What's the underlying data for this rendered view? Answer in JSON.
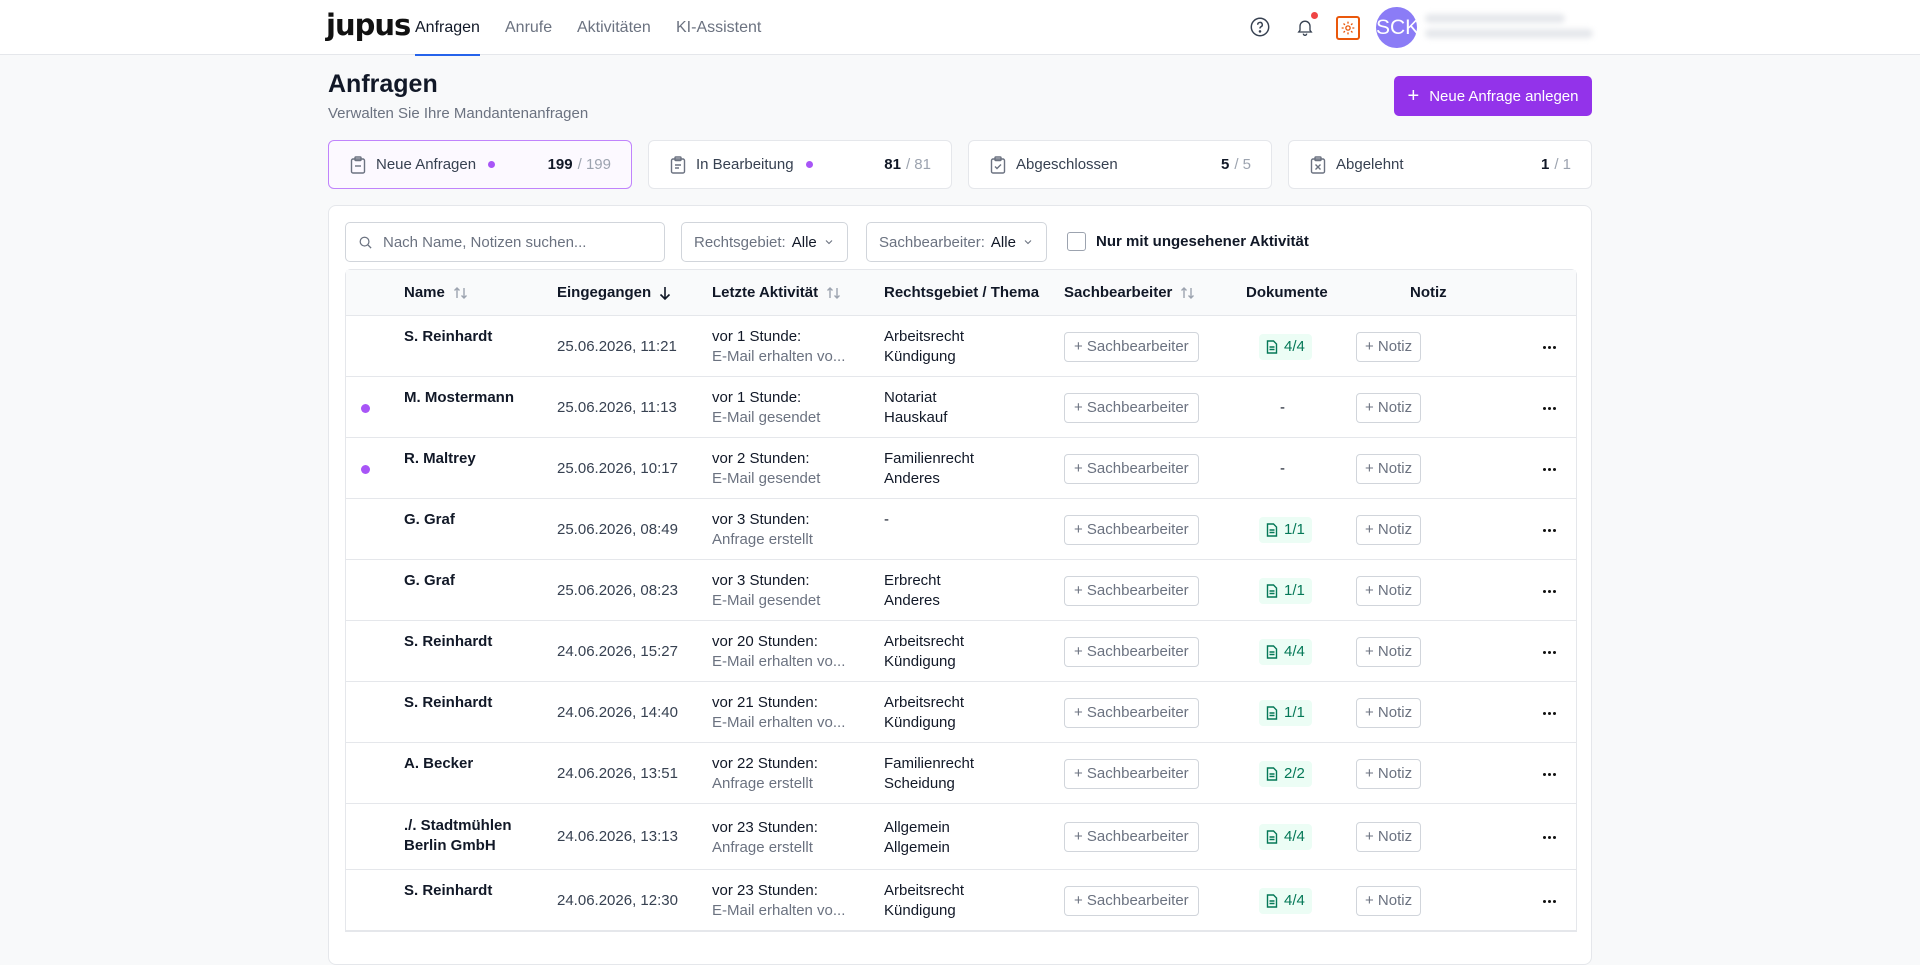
{
  "nav": {
    "logo": "jupus",
    "tabs": [
      "Anfragen",
      "Anrufe",
      "Aktivitäten",
      "KI-Assistent"
    ],
    "avatar_initials": "SCK"
  },
  "header": {
    "title": "Anfragen",
    "subtitle": "Verwalten Sie Ihre Mandantenanfragen",
    "new_button": "Neue Anfrage anlegen"
  },
  "status_cards": [
    {
      "label": "Neue Anfragen",
      "count": "199",
      "total": "/ 199",
      "dot": true
    },
    {
      "label": "In Bearbeitung",
      "count": "81",
      "total": "/ 81",
      "dot": true
    },
    {
      "label": "Abgeschlossen",
      "count": "5",
      "total": "/ 5",
      "dot": false
    },
    {
      "label": "Abgelehnt",
      "count": "1",
      "total": "/ 1",
      "dot": false
    }
  ],
  "filters": {
    "search_placeholder": "Nach Name, Notizen suchen...",
    "rechtsgebiet_label": "Rechtsgebiet:",
    "rechtsgebiet_value": "Alle",
    "sachbearbeiter_label": "Sachbearbeiter:",
    "sachbearbeiter_value": "Alle",
    "unseen_label": "Nur mit ungesehener Aktivität"
  },
  "table": {
    "columns": {
      "name": "Name",
      "eingegangen": "Eingegangen",
      "letzte_aktivitaet": "Letzte Aktivität",
      "rechtsgebiet": "Rechtsgebiet / Thema",
      "sachbearbeiter": "Sachbearbeiter",
      "dokumente": "Dokumente",
      "notiz": "Notiz"
    },
    "assign_label": "+ Sachbearbeiter",
    "note_label": "+ Notiz",
    "rows": [
      {
        "name": "S. Reinhardt",
        "date": "25.06.2026, 11:21",
        "act_time": "vor 1 Stunde:",
        "act_desc": "E-Mail erhalten vo...",
        "area": "Arbeitsrecht",
        "topic": "Kündigung",
        "docs": "4/4",
        "unread": false
      },
      {
        "name": "M. Mostermann",
        "date": "25.06.2026, 11:13",
        "act_time": "vor 1 Stunde:",
        "act_desc": "E-Mail gesendet",
        "area": "Notariat",
        "topic": "Hauskauf",
        "docs": "-",
        "unread": true
      },
      {
        "name": "R. Maltrey",
        "date": "25.06.2026, 10:17",
        "act_time": "vor 2 Stunden:",
        "act_desc": "E-Mail gesendet",
        "area": "Familienrecht",
        "topic": "Anderes",
        "docs": "-",
        "unread": true
      },
      {
        "name": "G. Graf",
        "date": "25.06.2026, 08:49",
        "act_time": "vor 3 Stunden:",
        "act_desc": "Anfrage erstellt",
        "area": "-",
        "topic": "",
        "docs": "1/1",
        "unread": false
      },
      {
        "name": "G. Graf",
        "date": "25.06.2026, 08:23",
        "act_time": "vor 3 Stunden:",
        "act_desc": "E-Mail gesendet",
        "area": "Erbrecht",
        "topic": "Anderes",
        "docs": "1/1",
        "unread": false
      },
      {
        "name": "S. Reinhardt",
        "date": "24.06.2026, 15:27",
        "act_time": "vor 20 Stunden:",
        "act_desc": "E-Mail erhalten vo...",
        "area": "Arbeitsrecht",
        "topic": "Kündigung",
        "docs": "4/4",
        "unread": false
      },
      {
        "name": "S. Reinhardt",
        "date": "24.06.2026, 14:40",
        "act_time": "vor 21 Stunden:",
        "act_desc": "E-Mail erhalten vo...",
        "area": "Arbeitsrecht",
        "topic": "Kündigung",
        "docs": "1/1",
        "unread": false
      },
      {
        "name": "A. Becker",
        "date": "24.06.2026, 13:51",
        "act_time": "vor 22 Stunden:",
        "act_desc": "Anfrage erstellt",
        "area": "Familienrecht",
        "topic": "Scheidung",
        "docs": "2/2",
        "unread": false
      },
      {
        "name": "./. Stadtmühlen Berlin GmbH",
        "date": "24.06.2026, 13:13",
        "act_time": "vor 23 Stunden:",
        "act_desc": "Anfrage erstellt",
        "area": "Allgemein",
        "topic": "Allgemein",
        "docs": "4/4",
        "unread": false
      },
      {
        "name": "S. Reinhardt",
        "date": "24.06.2026, 12:30",
        "act_time": "vor 23 Stunden:",
        "act_desc": "E-Mail erhalten vo...",
        "area": "Arbeitsrecht",
        "topic": "Kündigung",
        "docs": "4/4",
        "unread": false
      }
    ]
  },
  "colors": {
    "accent": "#9333ea",
    "nav_underline": "#2563eb",
    "unread_dot": "#a855f7",
    "doc_badge_bg": "#ecfdf5",
    "doc_badge_fg": "#047857"
  }
}
